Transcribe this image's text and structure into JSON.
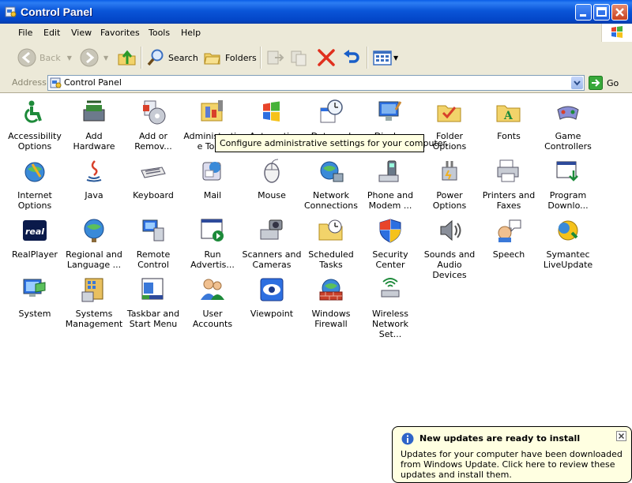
{
  "window": {
    "title": "Control Panel"
  },
  "menu": {
    "items": [
      "File",
      "Edit",
      "View",
      "Favorites",
      "Tools",
      "Help"
    ]
  },
  "toolbar": {
    "back": "Back",
    "search": "Search",
    "folders": "Folders"
  },
  "address": {
    "label": "Address",
    "value": "Control Panel",
    "go": "Go"
  },
  "items": [
    {
      "label": "Accessibility Options",
      "icon": "accessibility-icon"
    },
    {
      "label": "Add Hardware",
      "icon": "add-hardware-icon"
    },
    {
      "label": "Add or Remov...",
      "icon": "add-remove-programs-icon"
    },
    {
      "label": "Administrative Too...",
      "icon": "administrative-tools-icon"
    },
    {
      "label": "Automatic Updates",
      "icon": "automatic-updates-icon"
    },
    {
      "label": "Date and Time",
      "icon": "date-time-icon"
    },
    {
      "label": "Display",
      "icon": "display-icon"
    },
    {
      "label": "Folder Options",
      "icon": "folder-options-icon"
    },
    {
      "label": "Fonts",
      "icon": "fonts-icon"
    },
    {
      "label": "Game Controllers",
      "icon": "game-controllers-icon"
    },
    {
      "label": "Internet Options",
      "icon": "internet-options-icon"
    },
    {
      "label": "Java",
      "icon": "java-icon"
    },
    {
      "label": "Keyboard",
      "icon": "keyboard-icon"
    },
    {
      "label": "Mail",
      "icon": "mail-icon"
    },
    {
      "label": "Mouse",
      "icon": "mouse-icon"
    },
    {
      "label": "Network Connections",
      "icon": "network-connections-icon"
    },
    {
      "label": "Phone and Modem ...",
      "icon": "phone-modem-icon"
    },
    {
      "label": "Power Options",
      "icon": "power-options-icon"
    },
    {
      "label": "Printers and Faxes",
      "icon": "printers-faxes-icon"
    },
    {
      "label": "Program Downlo...",
      "icon": "program-download-icon"
    },
    {
      "label": "RealPlayer",
      "icon": "realplayer-icon"
    },
    {
      "label": "Regional and Language ...",
      "icon": "regional-language-icon"
    },
    {
      "label": "Remote Control",
      "icon": "remote-control-icon"
    },
    {
      "label": "Run Advertis...",
      "icon": "run-advertised-icon"
    },
    {
      "label": "Scanners and Cameras",
      "icon": "scanners-cameras-icon"
    },
    {
      "label": "Scheduled Tasks",
      "icon": "scheduled-tasks-icon"
    },
    {
      "label": "Security Center",
      "icon": "security-center-icon"
    },
    {
      "label": "Sounds and Audio Devices",
      "icon": "sounds-audio-icon"
    },
    {
      "label": "Speech",
      "icon": "speech-icon"
    },
    {
      "label": "Symantec LiveUpdate",
      "icon": "symantec-liveupdate-icon"
    },
    {
      "label": "System",
      "icon": "system-icon"
    },
    {
      "label": "Systems Management",
      "icon": "systems-management-icon"
    },
    {
      "label": "Taskbar and Start Menu",
      "icon": "taskbar-start-menu-icon"
    },
    {
      "label": "User Accounts",
      "icon": "user-accounts-icon"
    },
    {
      "label": "Viewpoint",
      "icon": "viewpoint-icon"
    },
    {
      "label": "Windows Firewall",
      "icon": "windows-firewall-icon"
    },
    {
      "label": "Wireless Network Set...",
      "icon": "wireless-network-icon"
    }
  ],
  "tooltip": {
    "text": "Configure administrative settings for your computer."
  },
  "balloon": {
    "title": "New updates are ready to install",
    "text": "Updates for your computer have been downloaded from Windows Update. Click here to review these updates and install them."
  },
  "colors": {
    "titlebar": "#0a55d8",
    "chrome": "#ece9d8",
    "tooltip_bg": "#ffffe1"
  }
}
